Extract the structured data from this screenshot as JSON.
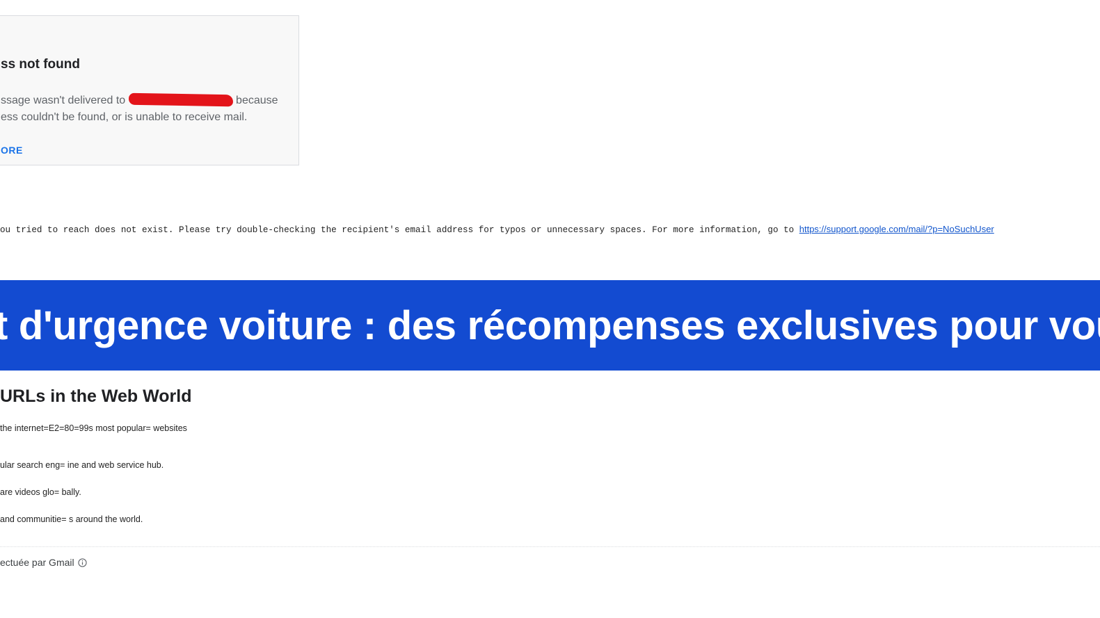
{
  "bounce_card": {
    "title": "ss not found",
    "body_before_redaction": "ssage wasn't delivered to ",
    "body_after_redaction": " because",
    "body_line2": "ess couldn't be found, or is unable to receive mail.",
    "more_label": "ORE"
  },
  "delivery_message": {
    "text": "ou tried to reach does not exist. Please try double-checking the recipient's email address for typos or unnecessary spaces. For more information, go to ",
    "link_text": "https://support.google.com/mail/?p=NoSuchUser"
  },
  "banner": {
    "text": "t d'urgence voiture : des récompenses exclusives pour vou",
    "color": "#134bd1"
  },
  "quoted_email": {
    "heading": "URLs in the Web World",
    "lines": [
      " the internet=E2=80=99s most popular= websites",
      "ular search eng= ine and web service hub.",
      "are videos glo= bally.",
      "and communitie= s around the world."
    ]
  },
  "footer": {
    "text": "ectuée par Gmail",
    "icon": "info-icon"
  }
}
